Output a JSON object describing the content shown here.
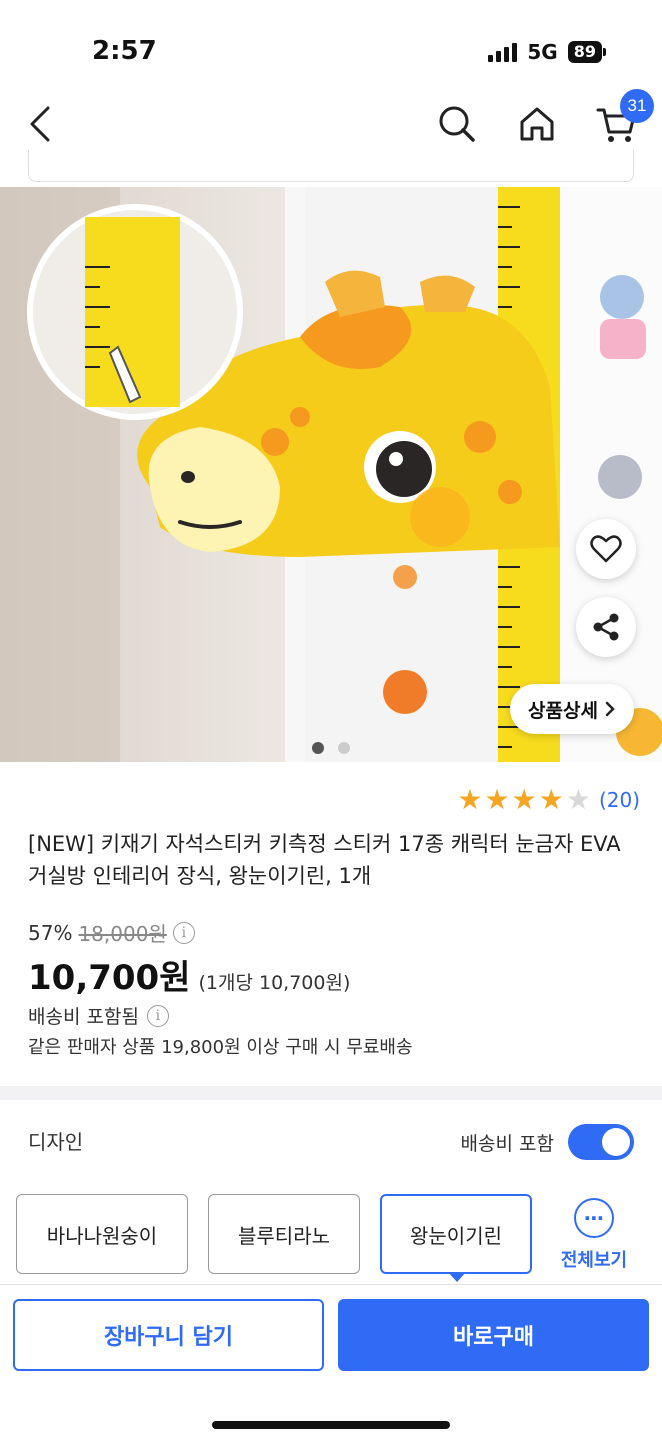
{
  "status_bar": {
    "time": "2:57",
    "network": "5G",
    "battery": "89",
    "icons": [
      "signal-icon",
      "battery-icon"
    ]
  },
  "nav": {
    "icons": [
      "back-icon",
      "search-icon",
      "home-icon",
      "cart-icon"
    ],
    "cart_count": "31"
  },
  "hero": {
    "detail_button_label": "상품상세",
    "image_count": 2,
    "active_image": 1,
    "icons": [
      "heart-icon",
      "share-icon",
      "chevron-right-icon"
    ]
  },
  "product": {
    "rating": 4,
    "rating_max": 5,
    "review_count": "(20)",
    "title": "[NEW] 키재기 자석스티커 키측정 스티커 17종 캐릭터 눈금자 EVA 거실방 인테리어 장식, 왕눈이기린, 1개",
    "discount": "57%",
    "original_price": "18,000원",
    "price": "10,700원",
    "unit_price": "(1개당 10,700원)",
    "shipping": "배송비 포함됨",
    "free_shipping_note": "같은 판매자 상품 19,800원 이상 구매 시 무료배송"
  },
  "options": {
    "label": "디자인",
    "shipping_toggle_label": "배송비 포함",
    "shipping_toggle_on": true,
    "items": [
      {
        "label": "바나나원숭이",
        "selected": false
      },
      {
        "label": "블루티라노",
        "selected": false
      },
      {
        "label": "왕눈이기린",
        "selected": true
      }
    ],
    "view_all_label": "전체보기"
  },
  "bottom_bar": {
    "add_to_cart": "장바구니 담기",
    "buy_now": "바로구매"
  },
  "colors": {
    "accent": "#2f6bf5",
    "star": "#f5a623"
  }
}
